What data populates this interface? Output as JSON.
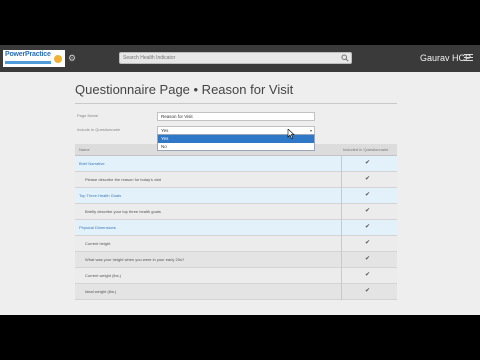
{
  "header": {
    "logo_text": "PowerPractice",
    "search_placeholder": "Search Health Indicator",
    "user_name": "Gaurav HCP"
  },
  "page": {
    "title": "Questionnaire Page • Reason for Visit"
  },
  "form": {
    "page_name_label": "Page Name",
    "page_name_value": "Reason for Visit",
    "include_label": "Include in Questionnaire",
    "include_value": "Yes",
    "include_options": [
      "Yes",
      "No"
    ],
    "include_selected": "Yes"
  },
  "table": {
    "headers": {
      "name": "Name",
      "included": "Included in Questionnaire"
    },
    "rows": [
      {
        "label": "Brief Narrative",
        "type": "section"
      },
      {
        "label": "Please describe the reason for today's visit",
        "type": "item"
      },
      {
        "label": "Top Three Health Goals",
        "type": "section"
      },
      {
        "label": "Briefly describe your top three health goals",
        "type": "item"
      },
      {
        "label": "Physical Dimensions",
        "type": "section"
      },
      {
        "label": "Current height",
        "type": "item"
      },
      {
        "label": "What was your height when you were in your early 20s?",
        "type": "item"
      },
      {
        "label": "Current weight (lbs.)",
        "type": "item"
      },
      {
        "label": "Ideal weight (lbs.)",
        "type": "item"
      }
    ],
    "check_glyph": "✔"
  }
}
